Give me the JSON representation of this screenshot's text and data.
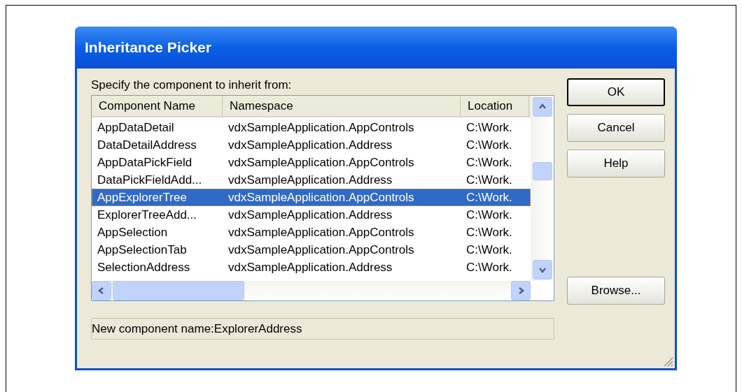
{
  "window": {
    "title": "Inheritance Picker"
  },
  "prompt": "Specify the component to inherit from:",
  "table": {
    "columns": [
      "Component Name",
      "Namespace",
      "Location"
    ],
    "rows": [
      {
        "cells": [
          "AppDataDetail",
          "vdxSampleApplication.AppControls",
          "C:\\Work."
        ],
        "selected": false
      },
      {
        "cells": [
          "DataDetailAddress",
          "vdxSampleApplication.Address",
          "C:\\Work."
        ],
        "selected": false
      },
      {
        "cells": [
          "AppDataPickField",
          "vdxSampleApplication.AppControls",
          "C:\\Work."
        ],
        "selected": false
      },
      {
        "cells": [
          "DataPickFieldAdd...",
          "vdxSampleApplication.Address",
          "C:\\Work."
        ],
        "selected": false
      },
      {
        "cells": [
          "AppExplorerTree",
          "vdxSampleApplication.AppControls",
          "C:\\Work."
        ],
        "selected": true
      },
      {
        "cells": [
          "ExplorerTreeAdd...",
          "vdxSampleApplication.Address",
          "C:\\Work."
        ],
        "selected": false
      },
      {
        "cells": [
          "AppSelection",
          "vdxSampleApplication.AppControls",
          "C:\\Work."
        ],
        "selected": false
      },
      {
        "cells": [
          "AppSelectionTab",
          "vdxSampleApplication.AppControls",
          "C:\\Work."
        ],
        "selected": false
      },
      {
        "cells": [
          "SelectionAddress",
          "vdxSampleApplication.Address",
          "C:\\Work."
        ],
        "selected": false
      }
    ]
  },
  "buttons": [
    {
      "label": "OK",
      "default": true
    },
    {
      "label": "Cancel",
      "default": false
    },
    {
      "label": "Help",
      "default": false
    }
  ],
  "browse_button": "Browse...",
  "status": "New component name:ExplorerAddress"
}
